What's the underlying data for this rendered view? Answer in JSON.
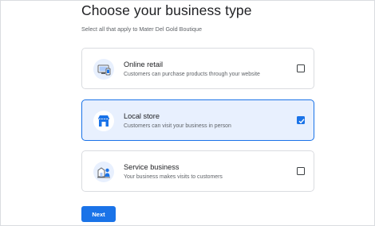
{
  "header": {
    "title": "Choose your business type",
    "subtitle": "Select all that apply to Mater Del Gold Boutique"
  },
  "options": [
    {
      "title": "Online retail",
      "description": "Customers can purchase products through your website",
      "icon": "online-retail-icon",
      "checked": false
    },
    {
      "title": "Local store",
      "description": "Customers can visit your business in person",
      "icon": "storefront-icon",
      "checked": true
    },
    {
      "title": "Service business",
      "description": "Your business makes visits to customers",
      "icon": "service-area-icon",
      "checked": false
    }
  ],
  "footer": {
    "next_label": "Next"
  },
  "colors": {
    "accent": "#1a73e8",
    "selected_bg": "#e8f0fe"
  }
}
